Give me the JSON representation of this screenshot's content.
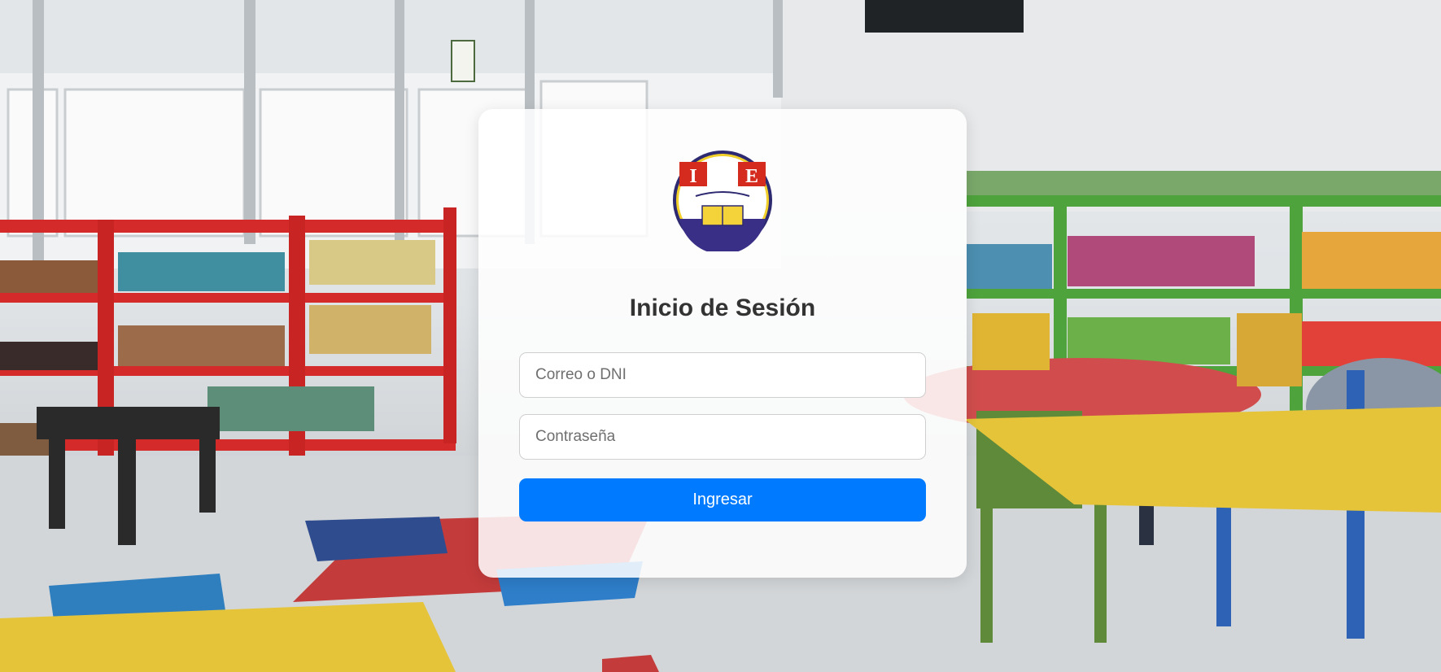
{
  "login": {
    "title": "Inicio de Sesión",
    "email_placeholder": "Correo o DNI",
    "password_placeholder": "Contraseña",
    "submit_label": "Ingresar"
  },
  "logo": {
    "text_left": "I",
    "text_right": "E"
  },
  "colors": {
    "primary": "#007bff",
    "title": "#333333"
  }
}
